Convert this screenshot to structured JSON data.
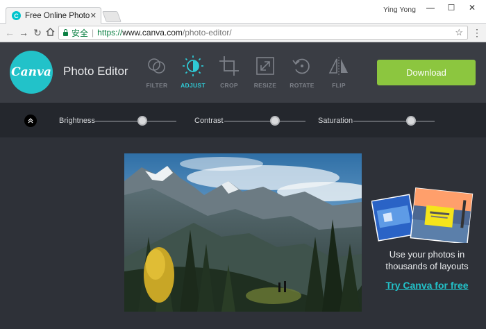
{
  "browser": {
    "tab_title": "Free Online Photo Editor",
    "tab_favicon": "C",
    "user_name": "Ying Yong",
    "secure_label": "安全",
    "url_scheme": "https://",
    "url_host": "www.canva.com",
    "url_path": "/photo-editor/"
  },
  "app": {
    "logo_text": "Canva",
    "title": "Photo Editor",
    "accent_color": "#2fc9d4",
    "download_label": "Download",
    "download_color": "#8cc63f",
    "tools": [
      {
        "label": "FILTER",
        "icon": "filter-icon",
        "active": false
      },
      {
        "label": "ADJUST",
        "icon": "adjust-icon",
        "active": true
      },
      {
        "label": "CROP",
        "icon": "crop-icon",
        "active": false
      },
      {
        "label": "RESIZE",
        "icon": "resize-icon",
        "active": false
      },
      {
        "label": "ROTATE",
        "icon": "rotate-icon",
        "active": false
      },
      {
        "label": "FLIP",
        "icon": "flip-icon",
        "active": false
      }
    ]
  },
  "adjust": {
    "sliders": [
      {
        "label": "Brightness",
        "value": 0.58
      },
      {
        "label": "Contrast",
        "value": 0.62
      },
      {
        "label": "Saturation",
        "value": 0.71
      }
    ]
  },
  "promo": {
    "text": "Use your photos in thousands of layouts",
    "link": "Try Canva for free"
  }
}
